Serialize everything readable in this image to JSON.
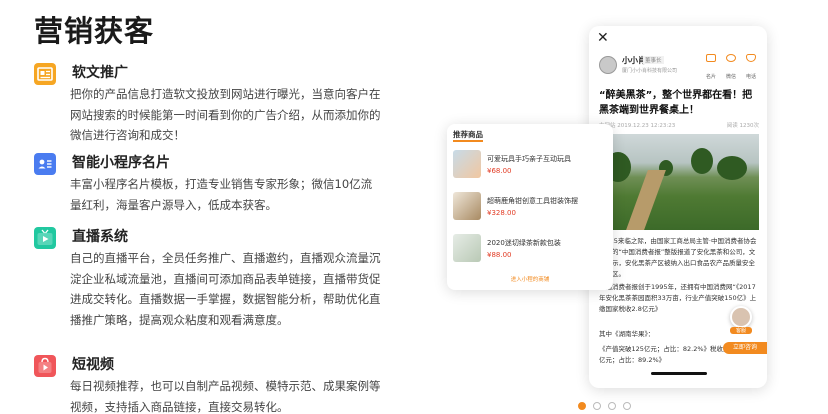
{
  "page": {
    "title": "营销获客"
  },
  "features": [
    {
      "title": "软文推广",
      "desc": "把你的产品信息打造软文投放到网站进行曝光，当意向客户在网站搜索的时候能第一时间看到你的广告介绍，从而添加你的微信进行咨询和成交！",
      "icon": "article-icon"
    },
    {
      "title": "智能小程序名片",
      "desc": "丰富小程序名片模板，打造专业销售专家形象；微信10亿流量红利，海量客户源导入，低成本获客。",
      "icon": "business-card-icon"
    },
    {
      "title": "直播系统",
      "desc": "自己的直播平台，全员任务推广、直播邀约，直播观众流量沉淀企业私域流量池，直播间可添加商品表单链接，直播带货促进成交转化。直播数据一手掌握，数据智能分析，帮助优化直播推广策略，提高观众粘度和观看满意度。",
      "icon": "live-play-icon"
    },
    {
      "title": "短视频",
      "desc": "每日视频推荐，也可以自制产品视频、模特示范、成果案例等视频，支持插入商品链接，直接交易转化。",
      "icon": "video-bag-icon"
    }
  ],
  "phone": {
    "close": "✕",
    "profile": {
      "name": "小小肖",
      "role": "董事长",
      "company": "厦门小小肖科技有限公司"
    },
    "actions": [
      {
        "label": "名片"
      },
      {
        "label": "微信"
      },
      {
        "label": "电话"
      }
    ],
    "headline": "“醉美黑茶”，整个世界都在看！把黑茶端到世界餐桌上！",
    "meta": {
      "date": "市网站 2019.12.23 12:23:23",
      "views": "阅读 1230次"
    },
    "body": [
      "4月15来临之际，由国家工商总局主管·中国消费者协会主办的“中国消费者报”整版报道了安化黑茶和公司，文章表示，安化黑茶产区被纳入出口食品农产品质量安全示范区。",
      "中国消费者报创于1995年，还拥有中国消费网“《2017年安化黑茶茶园面积33万亩，行业产值突破150亿》上缴国家税收2.8亿元》"
    ],
    "source": "其中《湖南华果》：",
    "quote": "《产值突破125亿元；占比：82.2%》税收突破2.5亿元；占比：89.2%》",
    "agent_label": "客服",
    "consult": "立即咨询"
  },
  "card": {
    "title": "推荐商品",
    "products": [
      {
        "name": "可爱玩具手巧亲子互动玩具",
        "price": "¥68.00"
      },
      {
        "name": "超萌鹿角钳创意工具钳装饰摆",
        "price": "¥328.00"
      },
      {
        "name": "2020迷切绿茶新款包装",
        "price": "¥88.00"
      }
    ],
    "link": "进入小程的商铺"
  },
  "colors": {
    "accent": "#f28a1f",
    "price": "#e23b24"
  },
  "pagination": {
    "count": 4,
    "active": 1
  }
}
